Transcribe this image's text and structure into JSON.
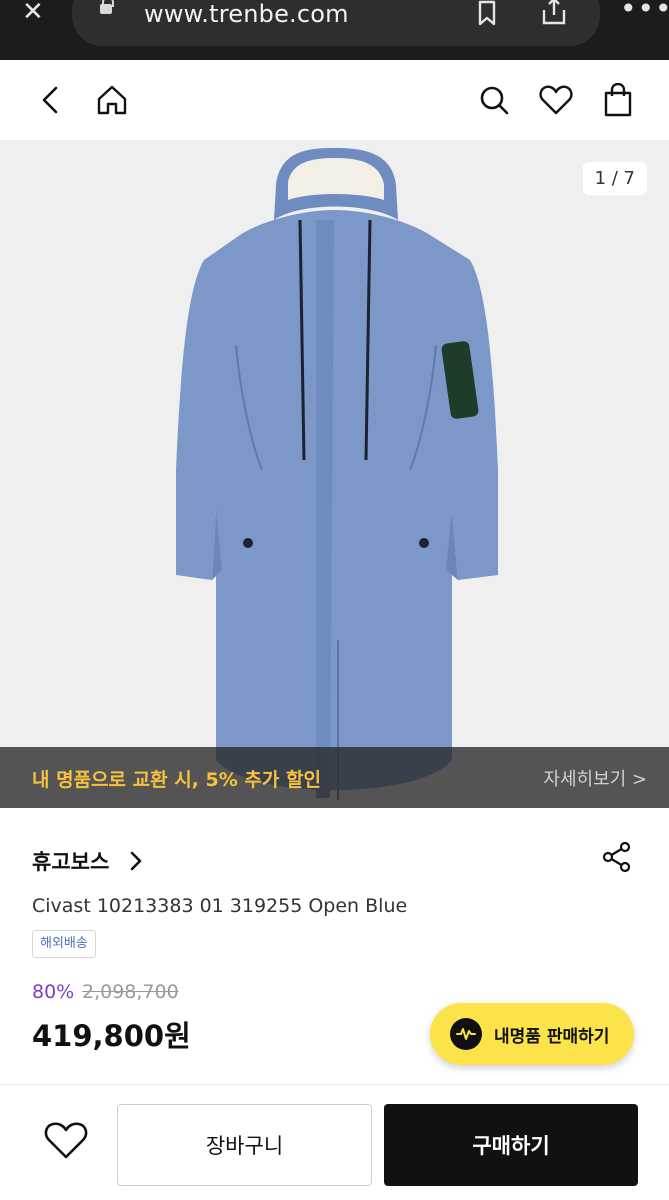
{
  "browser": {
    "url": "www.trenbe.com"
  },
  "gallery": {
    "counter": "1 / 7"
  },
  "promo": {
    "text": "내 명품으로 교환 시, 5% 추가 할인",
    "link_label": "자세히보기 >"
  },
  "product": {
    "brand": "휴고보스",
    "name": "Civast 10213383 01 319255 Open Blue",
    "shipping_badge": "해외배송",
    "discount": "80%",
    "original_price": "2,098,700",
    "price": "419,800원"
  },
  "sell_fab": {
    "label": "내명품 판매하기"
  },
  "bottom_bar": {
    "cart_label": "장바구니",
    "buy_label": "구매하기"
  },
  "colors": {
    "coat": "#7b98c9",
    "promo_text": "#f6c23e",
    "discount": "#7b3fc4",
    "fab": "#fde34a"
  }
}
